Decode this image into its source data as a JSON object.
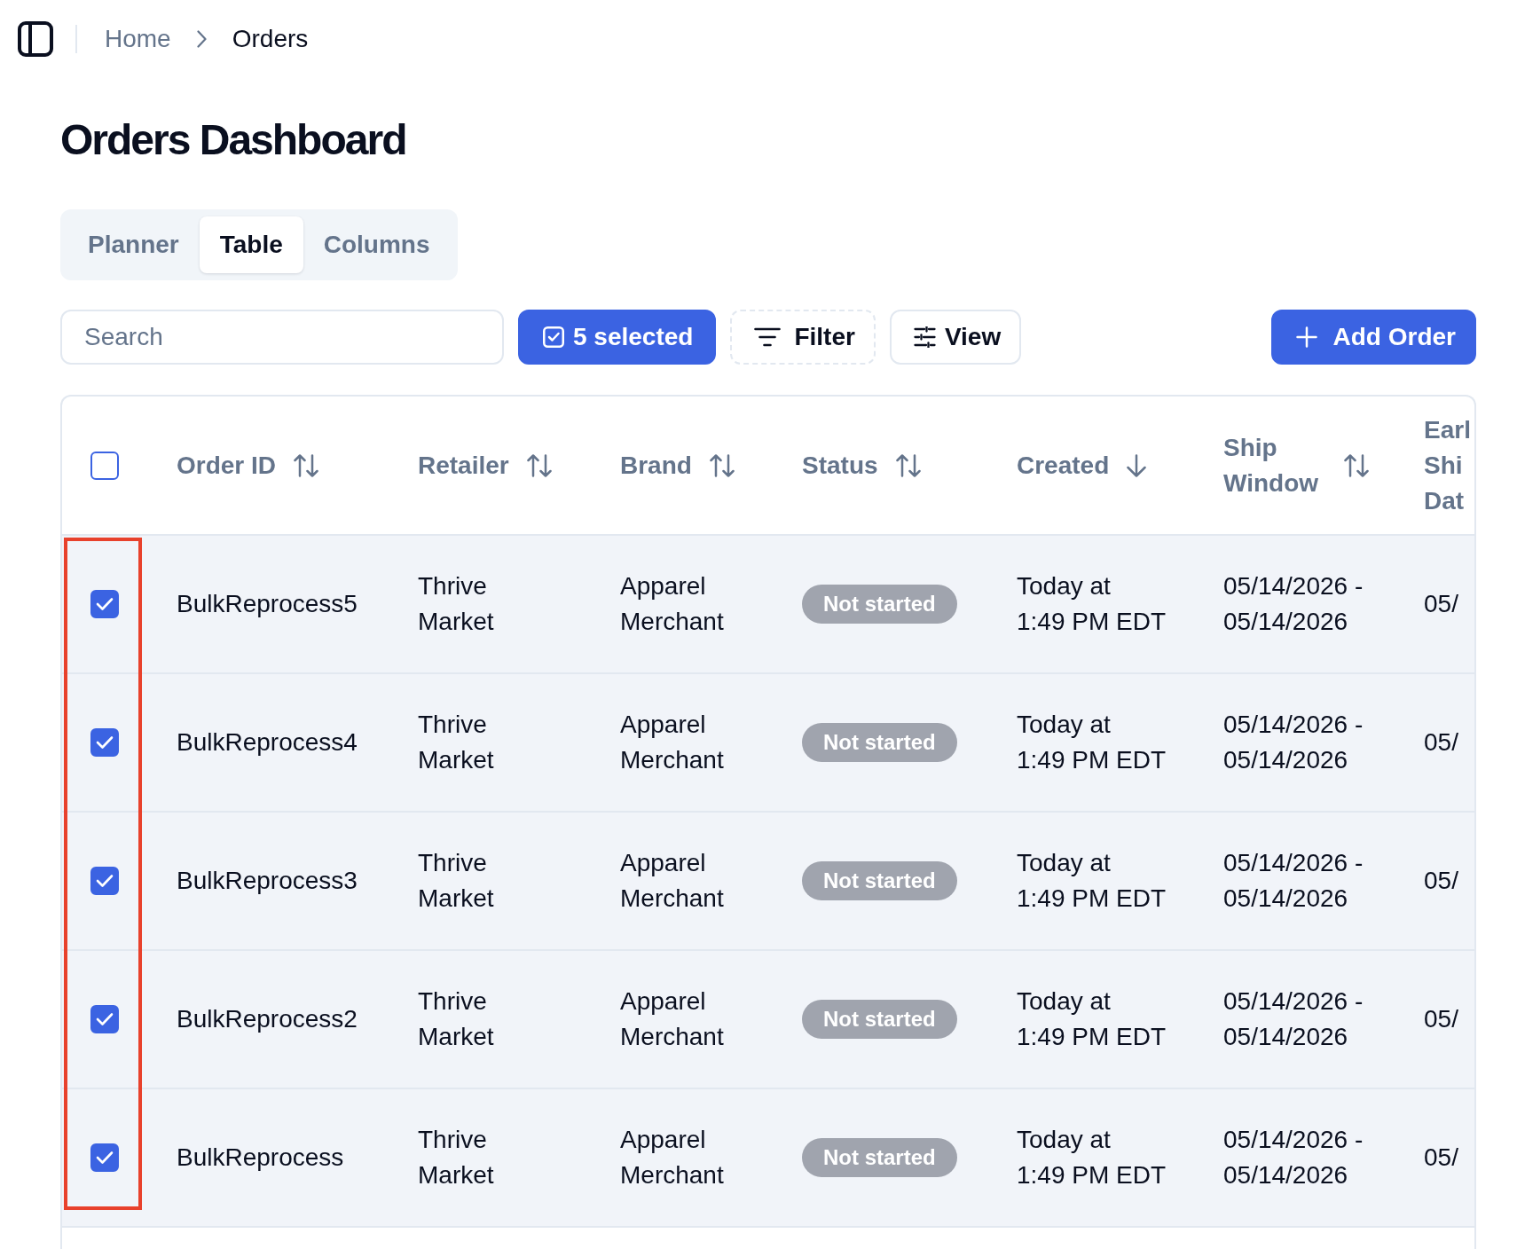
{
  "breadcrumb": [
    {
      "label": "Home",
      "current": false
    },
    {
      "label": "Orders",
      "current": true
    }
  ],
  "title": "Orders Dashboard",
  "tabs": [
    {
      "label": "Planner",
      "selected": false
    },
    {
      "label": "Table",
      "selected": true
    },
    {
      "label": "Columns",
      "selected": false
    }
  ],
  "toolbar": {
    "search": {
      "placeholder": "Search"
    },
    "actions": [
      {
        "kind": "selection",
        "label": "5 selected"
      },
      {
        "kind": "filter",
        "label": "Filter"
      },
      {
        "kind": "view",
        "label": "View"
      },
      {
        "kind": "add",
        "label": "Add Order"
      }
    ]
  },
  "table": {
    "select_all": {
      "checked": false
    },
    "highlight": {
      "kind": "checkbox-column"
    },
    "columns": [
      {
        "label": "Order ID",
        "sorted": false
      },
      {
        "label": "Retailer",
        "sorted": false
      },
      {
        "label": "Brand",
        "sorted": false
      },
      {
        "label": "Status",
        "sorted": false
      },
      {
        "label": "Created",
        "sorted": true
      },
      {
        "label": "Ship Window",
        "sorted": false
      },
      {
        "label": "Earl Shi Dat"
      }
    ],
    "rows": [
      {
        "selected": true,
        "order_id": "BulkReprocess5",
        "retailer": "Thrive Market",
        "brand": "Apparel Merchant",
        "status": "Not started",
        "created": "Today at\n1:49 PM EDT",
        "ship_window": "05/14/2026 - 05/14/2026",
        "column_7": "05/"
      },
      {
        "selected": true,
        "order_id": "BulkReprocess4",
        "retailer": "Thrive Market",
        "brand": "Apparel Merchant",
        "status": "Not started",
        "created": "Today at\n1:49 PM EDT",
        "ship_window": "05/14/2026 - 05/14/2026",
        "column_7": "05/"
      },
      {
        "selected": true,
        "order_id": "BulkReprocess3",
        "retailer": "Thrive Market",
        "brand": "Apparel Merchant",
        "status": "Not started",
        "created": "Today at\n1:49 PM EDT",
        "ship_window": "05/14/2026 - 05/14/2026",
        "column_7": "05/"
      },
      {
        "selected": true,
        "order_id": "BulkReprocess2",
        "retailer": "Thrive Market",
        "brand": "Apparel Merchant",
        "status": "Not started",
        "created": "Today at\n1:49 PM EDT",
        "ship_window": "05/14/2026 - 05/14/2026",
        "column_7": "05/"
      },
      {
        "selected": true,
        "order_id": "BulkReprocess",
        "retailer": "Thrive Market",
        "brand": "Apparel Merchant",
        "status": "Not started",
        "created": "Today at\n1:49 PM EDT",
        "ship_window": "05/14/2026 - 05/14/2026",
        "column_7": "05/"
      }
    ]
  }
}
